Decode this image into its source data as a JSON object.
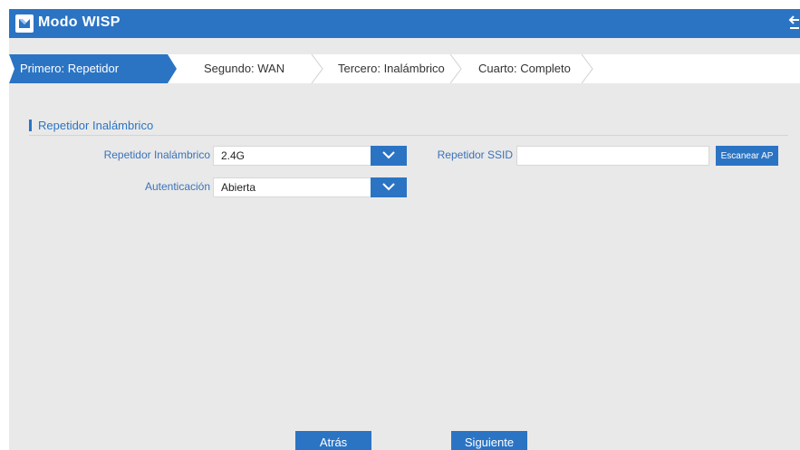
{
  "header": {
    "title": "Modo WISP"
  },
  "steps": [
    {
      "label": "Primero: Repetidor"
    },
    {
      "label": "Segundo: WAN"
    },
    {
      "label": "Tercero: Inalámbrico"
    },
    {
      "label": "Cuarto: Completo"
    }
  ],
  "section": {
    "title": "Repetidor Inalámbrico"
  },
  "form": {
    "band_label": "Repetidor Inalámbrico",
    "band_value": "2.4G",
    "auth_label": "Autenticación",
    "auth_value": "Abierta",
    "ssid_label": "Repetidor SSID",
    "ssid_value": "",
    "scan_label": "Escanear AP"
  },
  "footer": {
    "back_label": "Atrás",
    "next_label": "Siguiente"
  },
  "colors": {
    "accent": "#2b74c4",
    "background": "#e9e9e9",
    "label": "#3a72b8"
  }
}
